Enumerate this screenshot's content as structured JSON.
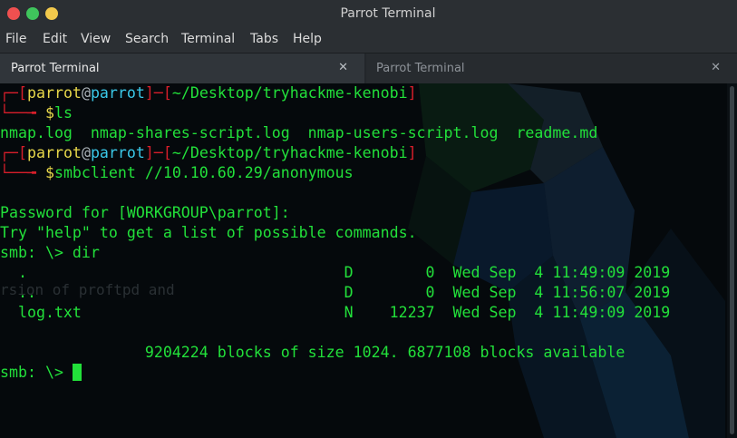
{
  "window": {
    "title": "Parrot Terminal"
  },
  "menu": [
    "File",
    "Edit",
    "View",
    "Search",
    "Terminal",
    "Tabs",
    "Help"
  ],
  "tabs": [
    {
      "label": "Parrot Terminal",
      "close": "✕"
    },
    {
      "label": "Parrot Terminal",
      "close": "✕"
    }
  ],
  "terminal": {
    "prompt1": {
      "corner": "┌─[",
      "user": "parrot",
      "at": "@",
      "host": "parrot",
      "sep": "]─[",
      "path": "~/Desktop/tryhackme-kenobi",
      "end": "]"
    },
    "cmd1": {
      "corner": "└──╼ ",
      "dollar": "$",
      "command": "ls"
    },
    "ls_output": "nmap.log  nmap-shares-script.log  nmap-users-script.log  readme.md",
    "prompt2": {
      "corner": "┌─[",
      "user": "parrot",
      "at": "@",
      "host": "parrot",
      "sep": "]─[",
      "path": "~/Desktop/tryhackme-kenobi",
      "end": "]"
    },
    "cmd2": {
      "corner": "└──╼ ",
      "dollar": "$",
      "command": "smbclient //10.10.60.29/anonymous"
    },
    "password_line": "Password for [WORKGROUP\\parrot]:",
    "help_line": "Try \"help\" to get a list of possible commands.",
    "dir_cmd": "smb: \\> dir",
    "dir_entries": [
      "  .                                   D        0  Wed Sep  4 11:49:09 2019",
      "  ..                                  D        0  Wed Sep  4 11:56:07 2019",
      "  log.txt                             N    12237  Wed Sep  4 11:49:09 2019"
    ],
    "blocks_line": "                9204224 blocks of size 1024. 6877108 blocks available",
    "final_prompt": "smb: \\> ",
    "ghost_text": "rsion of proftpd and"
  },
  "colors": {
    "prompt_frame": "#d61e2a",
    "user": "#e8d84a",
    "host": "#3ac8e8",
    "output": "#22e03a",
    "background": "#05090c"
  }
}
